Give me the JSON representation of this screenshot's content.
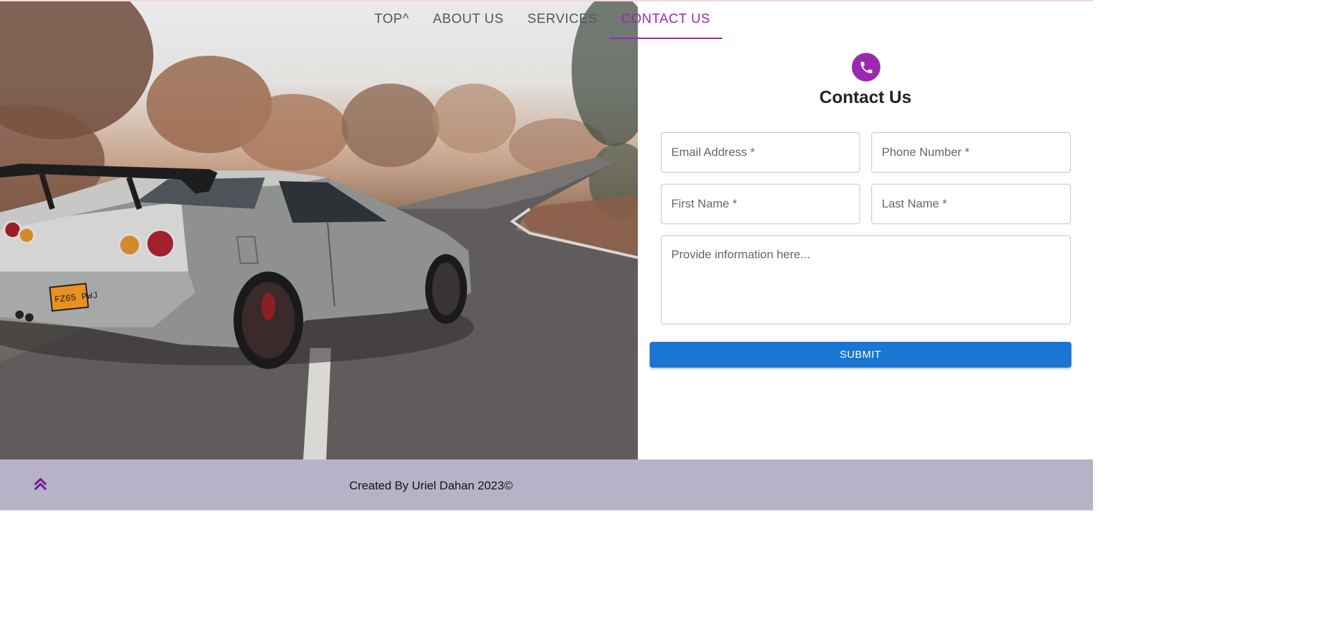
{
  "nav": {
    "items": [
      {
        "label": "TOP^"
      },
      {
        "label": "ABOUT US"
      },
      {
        "label": "SERVICES"
      },
      {
        "label": "CONTACT US"
      }
    ],
    "active_index": 3
  },
  "hero": {
    "image_alt": "Silver sports car drifting on a road",
    "license_plate": "FZ65 PWJ"
  },
  "contact": {
    "icon": "phone-icon",
    "title": "Contact Us",
    "email_placeholder": "Email Address *",
    "phone_placeholder": "Phone Number *",
    "first_name_placeholder": "First Name *",
    "last_name_placeholder": "Last Name *",
    "message_placeholder": "Provide information here...",
    "submit_label": "SUBMIT"
  },
  "footer": {
    "scroll_top_icon": "double-chevron-up-icon",
    "credit": "Created By Uriel Dahan 2023©"
  },
  "colors": {
    "accent": "#9c27b0",
    "button": "#1976d2",
    "footer_bg": "#b8b2c9"
  }
}
